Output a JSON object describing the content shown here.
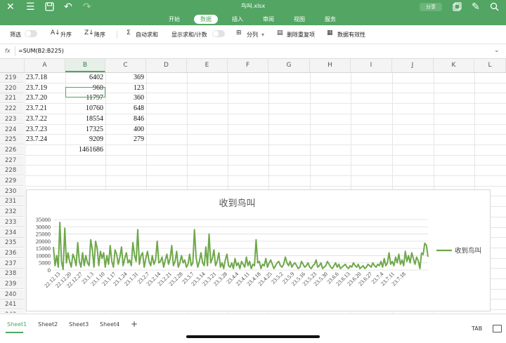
{
  "app": {
    "file_name": "鸟叫.xlsx",
    "share_label": "分享",
    "accent": "#52a563"
  },
  "icons": [
    "close-icon",
    "menu-icon",
    "save-icon",
    "undo-icon",
    "redo-icon",
    "panel-icon",
    "pen-icon",
    "search-icon"
  ],
  "ribbon_tabs": [
    {
      "label": "开始",
      "active": false
    },
    {
      "label": "数据",
      "active": true
    },
    {
      "label": "插入",
      "active": false
    },
    {
      "label": "审阅",
      "active": false
    },
    {
      "label": "视图",
      "active": false
    },
    {
      "label": "服务",
      "active": false
    }
  ],
  "toolbar": {
    "filter_label": "筛选",
    "sort_asc_label": "升序",
    "sort_desc_label": "降序",
    "autosum_label": "自动求和",
    "show_sum_label": "显示求和/计数",
    "split_label": "分列",
    "remove_dup_label": "删除重复项",
    "validation_label": "数据有效性"
  },
  "formula_bar": {
    "fx_label": "fx",
    "formula": "=SUM(B2:B225)"
  },
  "columns": [
    "A",
    "B",
    "C",
    "D",
    "E",
    "F",
    "G",
    "H",
    "I",
    "J",
    "K",
    "L"
  ],
  "rows": [
    {
      "num": "219",
      "a": "23.7.18",
      "b": "6402",
      "c": "369"
    },
    {
      "num": "220",
      "a": "23.7.19",
      "b": "960",
      "c": "123"
    },
    {
      "num": "221",
      "a": "23.7.20",
      "b": "11797",
      "c": "360"
    },
    {
      "num": "222",
      "a": "23.7.21",
      "b": "10760",
      "c": "648"
    },
    {
      "num": "223",
      "a": "23.7.22",
      "b": "18554",
      "c": "846"
    },
    {
      "num": "224",
      "a": "23.7.23",
      "b": "17325",
      "c": "400"
    },
    {
      "num": "225",
      "a": "23.7.24",
      "b": "9209",
      "c": "279"
    },
    {
      "num": "226",
      "a": "",
      "b": "1461686",
      "c": ""
    },
    {
      "num": "227",
      "a": "",
      "b": "",
      "c": ""
    },
    {
      "num": "228",
      "a": "",
      "b": "",
      "c": ""
    },
    {
      "num": "229",
      "a": "",
      "b": "",
      "c": ""
    },
    {
      "num": "230",
      "a": "",
      "b": "",
      "c": ""
    },
    {
      "num": "231",
      "a": "",
      "b": "",
      "c": ""
    },
    {
      "num": "232",
      "a": "",
      "b": "",
      "c": ""
    },
    {
      "num": "233",
      "a": "",
      "b": "",
      "c": ""
    },
    {
      "num": "234",
      "a": "",
      "b": "",
      "c": ""
    },
    {
      "num": "235",
      "a": "",
      "b": "",
      "c": ""
    },
    {
      "num": "236",
      "a": "",
      "b": "",
      "c": ""
    },
    {
      "num": "237",
      "a": "",
      "b": "",
      "c": ""
    },
    {
      "num": "238",
      "a": "",
      "b": "",
      "c": ""
    },
    {
      "num": "239",
      "a": "",
      "b": "",
      "c": ""
    },
    {
      "num": "240",
      "a": "",
      "b": "",
      "c": ""
    },
    {
      "num": "241",
      "a": "",
      "b": "",
      "c": ""
    },
    {
      "num": "242",
      "a": "",
      "b": "",
      "c": ""
    }
  ],
  "chart_data": {
    "type": "line",
    "title": "收到鸟叫",
    "legend": "right",
    "series_color": "#6ea84a",
    "ylim": [
      0,
      35000
    ],
    "y_ticks": [
      "0",
      "5000",
      "10000",
      "15000",
      "20000",
      "25000",
      "30000",
      "35000"
    ],
    "x_tick_labels": [
      "22.12.13",
      "22.12.20",
      "22.12.27",
      "23.1.3",
      "23.1.10",
      "23.1.17",
      "23.1.24",
      "23.1.31",
      "23.2.7",
      "23.2.14",
      "23.2.21",
      "23.2.28",
      "23.3.7",
      "23.3.14",
      "23.3.21",
      "23.3.28",
      "23.4.4",
      "23.4.11",
      "23.4.18",
      "23.4.25",
      "23.5.2",
      "23.5.9",
      "23.5.16",
      "23.5.23",
      "23.5.30",
      "23.6.6",
      "23.6.13",
      "23.6.20",
      "23.6.27",
      "23.7.4",
      "23.7.11",
      "23.7.18"
    ],
    "series": [
      {
        "name": "收到鸟叫",
        "values": [
          16000,
          3000,
          10000,
          2000,
          33000,
          6000,
          500,
          29000,
          5000,
          12000,
          6000,
          2000,
          11000,
          8000,
          3000,
          19000,
          6000,
          2000,
          12000,
          3000,
          10000,
          5000,
          3000,
          21000,
          14000,
          2000,
          20000,
          15000,
          3000,
          13000,
          8000,
          12000,
          2000,
          10000,
          4000,
          17000,
          6000,
          2000,
          14000,
          11000,
          4000,
          9000,
          16000,
          3000,
          8000,
          12000,
          5000,
          7000,
          3000,
          19000,
          10000,
          6000,
          28000,
          4000,
          10000,
          12000,
          2000,
          8000,
          13000,
          6000,
          3000,
          10000,
          4000,
          7000,
          20000,
          5000,
          6000,
          9000,
          2000,
          7000,
          11000,
          4000,
          8000,
          17000,
          3000,
          6000,
          13000,
          2000,
          5000,
          10000,
          5000,
          7000,
          2000,
          4000,
          11000,
          3000,
          5000,
          28000,
          9000,
          2000,
          6000,
          12000,
          5000,
          3000,
          16000,
          3000,
          25000,
          5000,
          8000,
          14000,
          3000,
          6000,
          12000,
          2000,
          5000,
          1000,
          7000,
          11000,
          3000,
          2000,
          5000,
          1000,
          8000,
          3000,
          5000,
          1000,
          6000,
          4000,
          2000,
          9000,
          3000,
          6000,
          1000,
          4000,
          3000,
          21000,
          5000,
          6000,
          1000,
          4000,
          3000,
          8000,
          2000,
          5000,
          7000,
          4000,
          1000,
          3000,
          5000,
          6000,
          3000,
          2000,
          4000,
          9000,
          5000,
          3000,
          6000,
          2000,
          4000,
          5000,
          3000,
          1000,
          2000,
          6000,
          4000,
          2000,
          3000,
          5000,
          2000,
          1000,
          3000,
          4000,
          7000,
          2000,
          3000,
          5000,
          1000,
          2000,
          3000,
          6000,
          4000,
          2000,
          1000,
          3000,
          5000,
          2000,
          4000,
          1000,
          2000,
          3000,
          4000,
          2000,
          1000,
          3000,
          2000,
          5000,
          3000,
          2000,
          4000,
          1000,
          2000,
          3000,
          1000,
          2000,
          4000,
          3000,
          2000,
          5000,
          3000,
          2000,
          4000,
          3000,
          6000,
          2000,
          8000,
          3000,
          5000,
          12000,
          4000,
          6000,
          3000,
          9000,
          5000,
          11000,
          4000,
          7000,
          3000,
          13000,
          6000,
          10000,
          5000,
          12000,
          8000,
          4000,
          9000,
          6400,
          960,
          11797,
          10760,
          18554,
          17325,
          9209
        ]
      }
    ]
  },
  "sheets": [
    {
      "label": "Sheet1",
      "active": true
    },
    {
      "label": "Sheet2",
      "active": false
    },
    {
      "label": "Sheet3",
      "active": false
    },
    {
      "label": "Sheet4",
      "active": false
    }
  ],
  "add_sheet_label": "+",
  "tab_key_label": "TAB"
}
